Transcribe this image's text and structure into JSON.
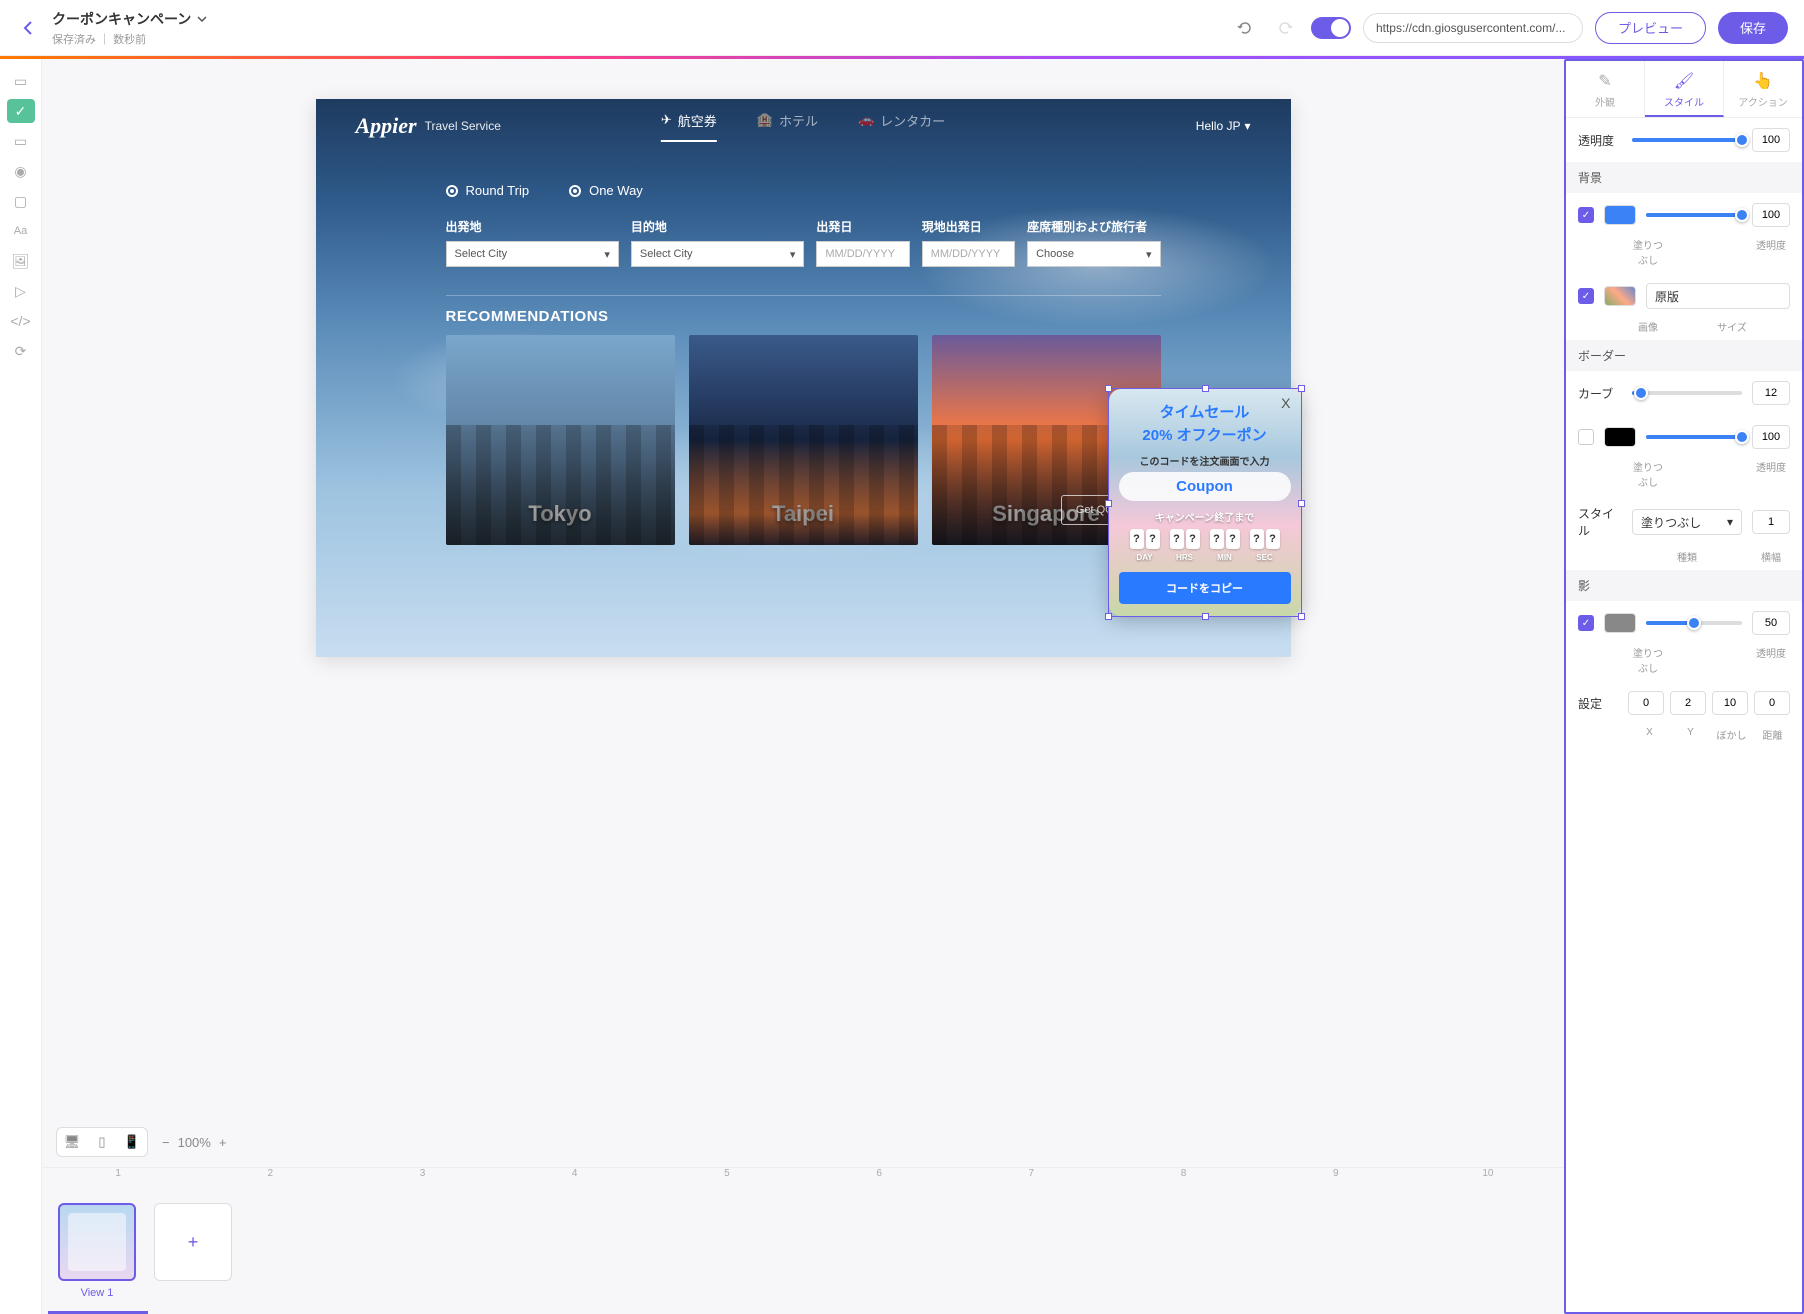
{
  "header": {
    "title": "クーポンキャンペーン",
    "saved_label": "保存済み",
    "saved_time": "数秒前",
    "url": "https://cdn.giosgusercontent.com/...",
    "preview": "プレビュー",
    "save": "保存"
  },
  "left_tools": [
    "layout",
    "check",
    "input",
    "radio",
    "rect",
    "text",
    "image",
    "embed",
    "code",
    "refresh"
  ],
  "right_panel": {
    "tabs": {
      "appearance": "外観",
      "style": "スタイル",
      "action": "アクション"
    },
    "opacity": {
      "label": "透明度",
      "value": "100"
    },
    "background": {
      "title": "背景",
      "fill_label": "塗りつぶし",
      "fill_opacity_label": "透明度",
      "fill_opacity": "100",
      "image_label": "画像",
      "size_label": "サイズ",
      "size_value": "原版"
    },
    "border": {
      "title": "ボーダー",
      "curve_label": "カーブ",
      "curve_value": "12",
      "fill_label": "塗りつぶし",
      "opacity_label": "透明度",
      "opacity_value": "100",
      "style_label": "スタイル",
      "kind_label": "種類",
      "kind_value": "塗りつぶし",
      "width_label": "横幅",
      "width_value": "1"
    },
    "shadow": {
      "title": "影",
      "fill_label": "塗りつぶし",
      "opacity_label": "透明度",
      "opacity_value": "50",
      "settings_label": "設定",
      "x": "0",
      "y": "2",
      "blur": "10",
      "dist": "0",
      "x_l": "X",
      "y_l": "Y",
      "blur_l": "ぼかし",
      "dist_l": "距離"
    }
  },
  "site": {
    "logo": "Appier",
    "logo_sub": "Travel Service",
    "tabs": {
      "flight": "航空券",
      "hotel": "ホテル",
      "car": "レンタカー"
    },
    "hello": "Hello JP",
    "trip": {
      "round": "Round Trip",
      "one": "One Way"
    },
    "form": {
      "dep_label": "出発地",
      "dep_value": "Select City",
      "dest_label": "目的地",
      "dest_value": "Select City",
      "dep_date_label": "出発日",
      "dep_date_ph": "MM/DD/YYYY",
      "ret_date_label": "現地出発日",
      "ret_date_ph": "MM/DD/YYYY",
      "class_label": "座席種別および旅行者",
      "class_value": "Choose"
    },
    "reco_title": "RECOMMENDATIONS",
    "reco": {
      "tokyo": "Tokyo",
      "taipei": "Taipei",
      "singapore": "Singapore"
    },
    "get_btn": "Get QGUser..."
  },
  "popup": {
    "close": "X",
    "line1": "タイムセール",
    "line2": "20% オフクーポン",
    "desc": "このコードを注文画面で入力",
    "coupon": "Coupon",
    "end": "キャンペーン終了まで",
    "digit": "?",
    "day": "DAY",
    "hrs": "HRS",
    "min": "MIN",
    "sec": "SEC",
    "copy": "コードをコピー"
  },
  "bottom": {
    "zoom": "100%",
    "ticks": [
      "1",
      "2",
      "3",
      "4",
      "5",
      "6",
      "7",
      "8",
      "9",
      "10"
    ],
    "view1": "View 1"
  }
}
